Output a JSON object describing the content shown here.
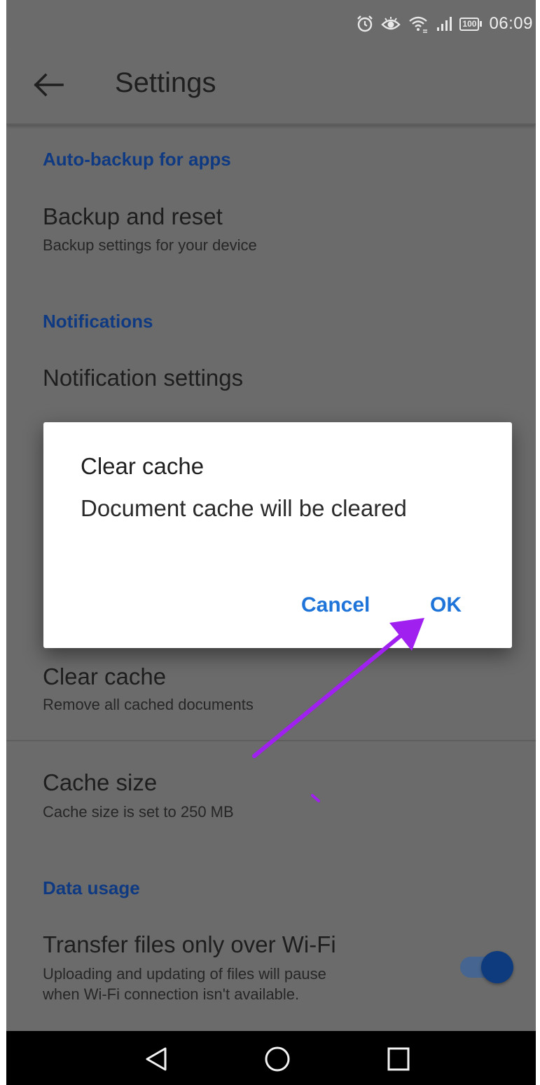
{
  "status_bar": {
    "battery": "100",
    "time": "06:09",
    "icons": [
      "alarm-icon",
      "eye-icon",
      "wifi-icon",
      "signal-icon",
      "battery-icon"
    ]
  },
  "app_bar": {
    "back_icon": "back-arrow-icon",
    "title": "Settings"
  },
  "sections": {
    "auto_backup": {
      "header": "Auto-backup for apps",
      "backup_title": "Backup and reset",
      "backup_sub": "Backup settings for your device"
    },
    "notifications": {
      "header": "Notifications",
      "settings_title": "Notification settings"
    },
    "cache": {
      "clear_title": "Clear cache",
      "clear_sub": "Remove all cached documents",
      "size_title": "Cache size",
      "size_sub": "Cache size is set to 250 MB"
    },
    "data_usage": {
      "header": "Data usage",
      "wifi_title": "Transfer files only over Wi-Fi",
      "wifi_sub_1": "Uploading and updating of files will pause",
      "wifi_sub_2": "when Wi-Fi connection isn't available.",
      "wifi_toggle_on": true
    }
  },
  "dialog": {
    "title": "Clear cache",
    "message": "Document cache will be cleared",
    "cancel_label": "Cancel",
    "ok_label": "OK"
  },
  "nav_bar": {
    "icons": [
      "nav-back-icon",
      "nav-home-icon",
      "nav-recents-icon"
    ]
  },
  "colors": {
    "scrim_background": "#6b6b6b",
    "section_header": "#0f3a82",
    "dialog_button": "#1e74d8",
    "annotation_arrow": "#a020f0",
    "toggle_thumb": "#0e3b7e"
  }
}
